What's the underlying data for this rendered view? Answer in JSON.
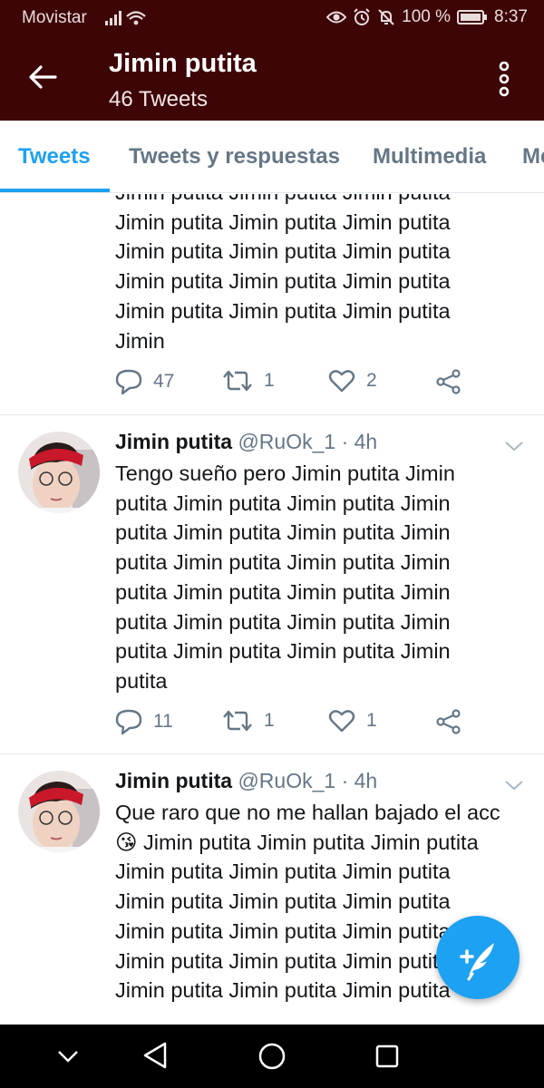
{
  "status": {
    "carrier": "Movistar",
    "battery": "100 %",
    "time": "8:37"
  },
  "header": {
    "title": "Jimin putita",
    "subtitle": "46 Tweets"
  },
  "tabs": [
    {
      "label": "Tweets",
      "active": true
    },
    {
      "label": "Tweets y respuestas",
      "active": false
    },
    {
      "label": "Multimedia",
      "active": false
    },
    {
      "label": "Me",
      "active": false
    }
  ],
  "colors": {
    "header_bg": "#3e0507",
    "accent": "#1da1f2",
    "muted": "#657786"
  },
  "tweets": [
    {
      "partial": true,
      "lines": [
        "Jimin putita Jimin putita Jimin putita",
        "Jimin putita Jimin putita Jimin putita",
        "Jimin putita Jimin putita Jimin putita",
        "Jimin putita Jimin putita Jimin putita",
        "Jimin putita Jimin putita Jimin putita",
        "Jimin"
      ],
      "replies": "47",
      "retweets": "1",
      "likes": "2"
    },
    {
      "name": "Jimin putita",
      "handle": "@RuOk_1 · 4h",
      "lines": [
        "Tengo sueño pero Jimin putita Jimin",
        "putita Jimin putita Jimin putita Jimin",
        "putita Jimin putita Jimin putita Jimin",
        "putita Jimin putita Jimin putita Jimin",
        "putita Jimin putita Jimin putita Jimin",
        "putita Jimin putita Jimin putita Jimin",
        "putita Jimin putita Jimin putita Jimin",
        "putita"
      ],
      "replies": "11",
      "retweets": "1",
      "likes": "1"
    },
    {
      "name": "Jimin putita",
      "handle": "@RuOk_1 · 4h",
      "lines": [
        "Que raro que no me hallan bajado el acc",
        "😘 Jimin putita Jimin putita Jimin putita",
        "Jimin putita Jimin putita Jimin putita",
        "Jimin putita Jimin putita Jimin putita",
        "Jimin putita Jimin putita Jimin putita",
        "Jimin putita Jimin putita Jimin putita",
        "Jimin putita Jimin putita Jimin putita"
      ]
    }
  ],
  "icons": {
    "back": "arrow-left-icon",
    "more": "kebab-icon",
    "reply": "reply-icon",
    "retweet": "retweet-icon",
    "like": "heart-icon",
    "share": "share-icon",
    "compose": "compose-tweet-icon",
    "nav": [
      "nav-hide-icon",
      "nav-back-icon",
      "nav-home-icon",
      "nav-recents-icon"
    ]
  }
}
